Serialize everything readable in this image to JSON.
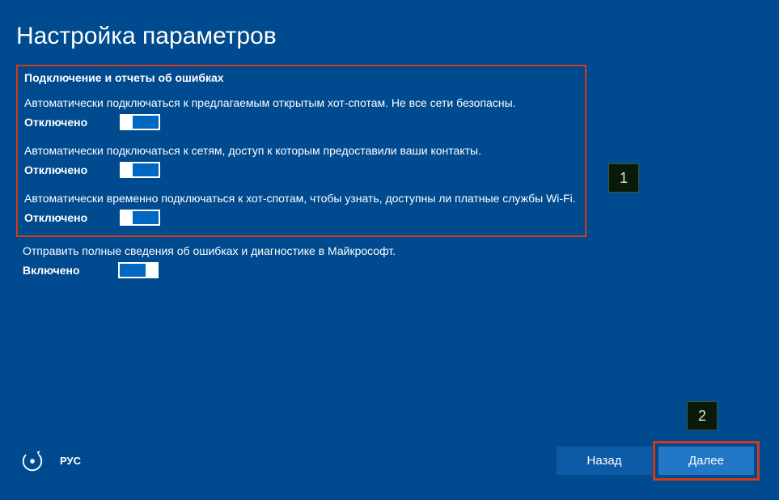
{
  "title": "Настройка параметров",
  "section": {
    "heading": "Подключение и отчеты об ошибках",
    "settings": [
      {
        "desc": "Автоматически подключаться к предлагаемым открытым хот-спотам. Не все сети безопасны.",
        "state": "Отключено",
        "on": false
      },
      {
        "desc": "Автоматически подключаться к сетям, доступ к которым предоставили ваши контакты.",
        "state": "Отключено",
        "on": false
      },
      {
        "desc": "Автоматически временно подключаться к хот-спотам, чтобы узнать, доступны ли платные службы Wi-Fi.",
        "state": "Отключено",
        "on": false
      }
    ]
  },
  "extra_setting": {
    "desc": "Отправить полные сведения об ошибках и диагностике в Майкрософт.",
    "state": "Включено",
    "on": true
  },
  "annotations": {
    "a1": "1",
    "a2": "2"
  },
  "footer": {
    "lang": "РУС",
    "back": "Назад",
    "next": "Далее"
  }
}
